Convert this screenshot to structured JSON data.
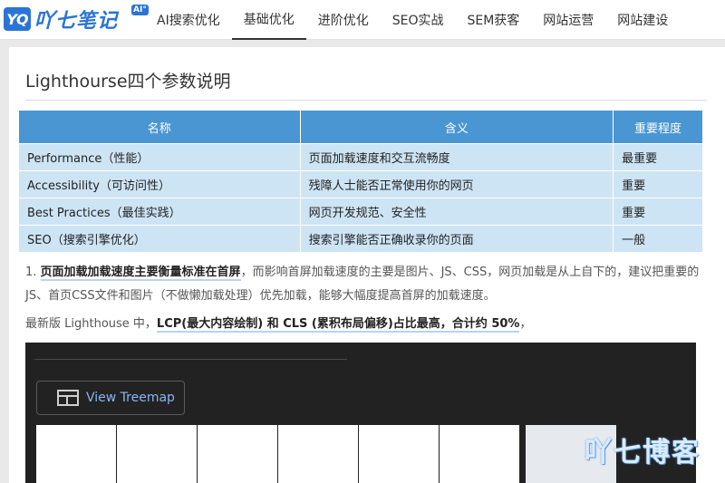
{
  "header": {
    "logo_mark": "YQ",
    "logo_text": "吖七笔记",
    "logo_sup": "AI°",
    "nav": [
      {
        "label": "AI搜索优化",
        "active": false
      },
      {
        "label": "基础优化",
        "active": true
      },
      {
        "label": "进阶优化",
        "active": false
      },
      {
        "label": "SEO实战",
        "active": false
      },
      {
        "label": "SEM获客",
        "active": false
      },
      {
        "label": "网站运营",
        "active": false
      },
      {
        "label": "网站建设",
        "active": false
      }
    ]
  },
  "article": {
    "title": "Lighthourse四个参数说明",
    "table": {
      "headers": [
        "名称",
        "含义",
        "重要程度"
      ],
      "rows": [
        [
          "Performance（性能）",
          "页面加载速度和交互流畅度",
          "最重要"
        ],
        [
          "Accessibility（可访问性）",
          "残障人士能否正常使用你的网页",
          "重要"
        ],
        [
          "Best Practices（最佳实践）",
          "网页开发规范、安全性",
          "重要"
        ],
        [
          "SEO（搜索引擎优化）",
          "搜索引擎能否正确收录你的页面",
          "一般"
        ]
      ]
    },
    "para1": {
      "prefix": "1. ",
      "highlight": "页面加载加载速度主要衡量标准在首屏",
      "rest": "，而影响首屏加载速度的主要是图片、JS、CSS，网页加载是从上自下的，建议把重要的JS、首页CSS文件和图片（不做懒加载处理）优先加载，能够大幅度提高首屏的加载速度。"
    },
    "para2": {
      "prefix": "最新版 Lighthouse 中，",
      "highlight": "LCP(最大内容绘制) 和 CLS (累积布局偏移)占比最高，合计约 50%",
      "suffix": "，"
    },
    "screenshot": {
      "button_label": "View Treemap"
    }
  },
  "watermark": "吖七博客",
  "colors": {
    "brand": "#2a74d6",
    "table_header": "#4a96d2",
    "table_cell": "#cde4f4",
    "link_blue": "#8ab4f8"
  }
}
